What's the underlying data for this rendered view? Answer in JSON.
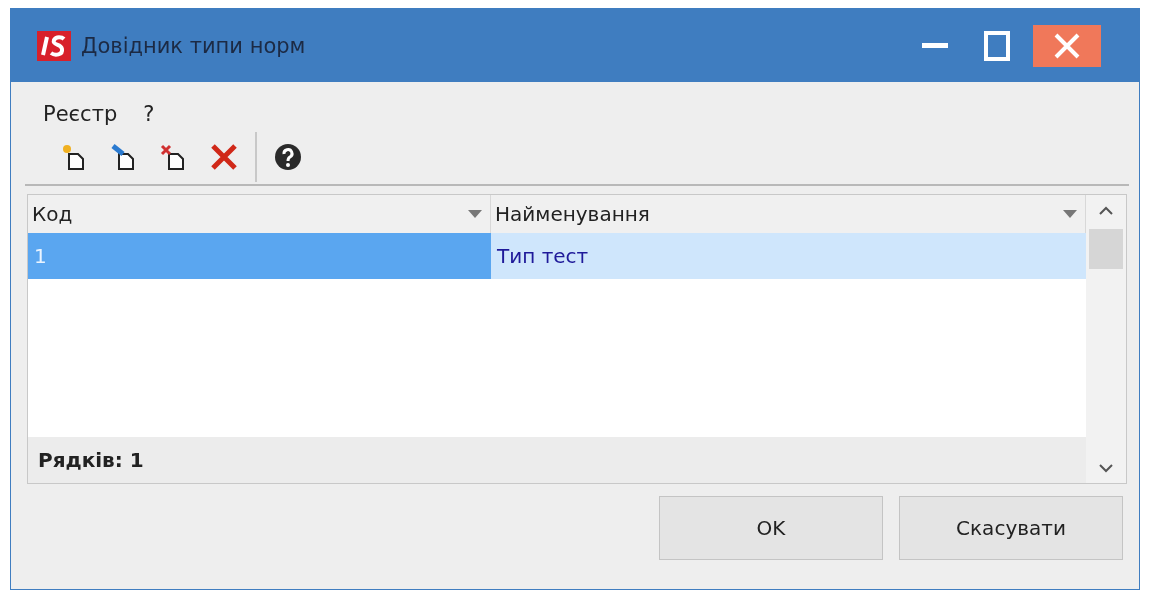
{
  "window": {
    "title": "Довідник типи норм"
  },
  "menu": [
    "Реєстр",
    "?"
  ],
  "toolbar": [
    {
      "kind": "add"
    },
    {
      "kind": "edit"
    },
    {
      "kind": "copy"
    },
    {
      "kind": "delete"
    },
    {
      "kind": "separator"
    },
    {
      "kind": "help"
    }
  ],
  "table": {
    "columns": [
      "Код",
      "Найменування"
    ],
    "rows": [
      {
        "cells": [
          "1",
          "Тип тест"
        ],
        "selected": true
      }
    ],
    "footer": "Рядків: 1"
  },
  "buttons": [
    "OK",
    "Скасувати"
  ]
}
